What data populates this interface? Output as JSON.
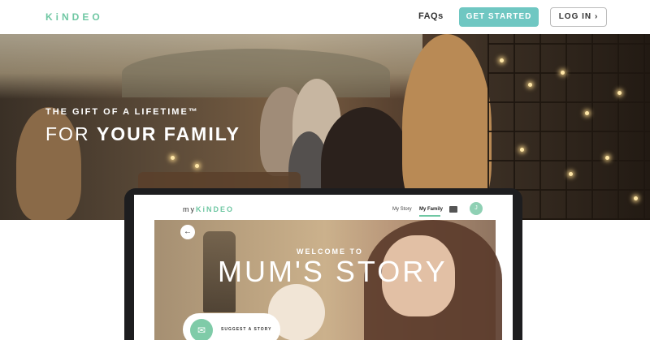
{
  "header": {
    "logo": "KiNDEO",
    "faq_label": "FAQs",
    "get_started_label": "GET STARTED",
    "login_label": "LOG IN",
    "login_chevron": "›"
  },
  "hero": {
    "subtitle": "THE GIFT OF A LIFETIME™",
    "title_prefix": "FOR ",
    "title_bold": "YOUR FAMILY"
  },
  "app": {
    "logo_prefix": "my",
    "logo_brand": "KiNDEO",
    "tabs": [
      {
        "label": "My Story"
      },
      {
        "label": "My Family"
      }
    ],
    "avatar_initial": "J",
    "back_arrow": "←",
    "welcome": "WELCOME TO",
    "story_title": "MUM'S STORY",
    "suggest_label": "SUGGEST A STORY",
    "suggest_icon_glyph": "✉"
  },
  "colors": {
    "brand_green": "#6fc7a3",
    "button_teal": "#6fc7c2"
  }
}
